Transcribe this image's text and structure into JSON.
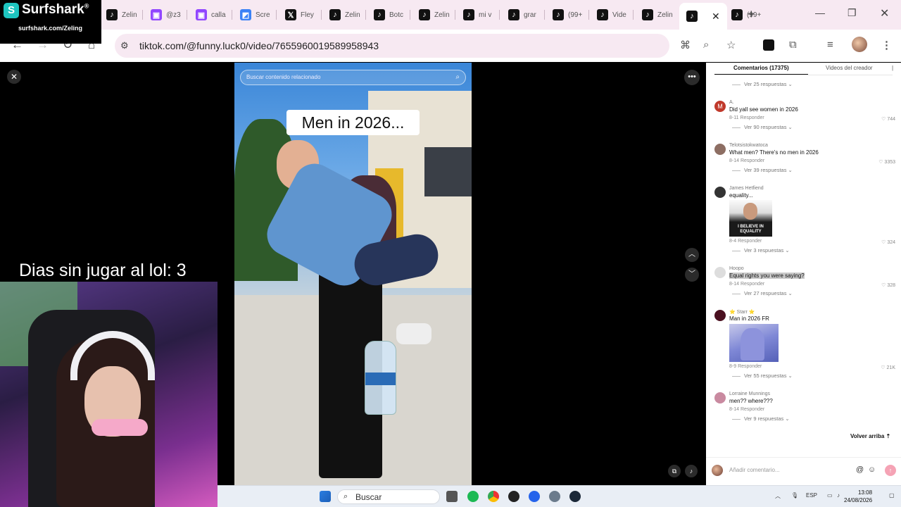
{
  "browser": {
    "tabs": [
      {
        "label": "Zelin",
        "icon": "tiktok-icon"
      },
      {
        "label": "@z3",
        "icon": "twitch-icon"
      },
      {
        "label": "calla",
        "icon": "twitch-icon"
      },
      {
        "label": "Scre",
        "icon": "screen-icon"
      },
      {
        "label": "Fley",
        "icon": "x-icon"
      },
      {
        "label": "Zelin",
        "icon": "tiktok-icon"
      },
      {
        "label": "Botc",
        "icon": "tiktok-icon"
      },
      {
        "label": "Zelin",
        "icon": "tiktok-icon"
      },
      {
        "label": "mi v",
        "icon": "tiktok-icon"
      },
      {
        "label": "grar",
        "icon": "tiktok-icon"
      },
      {
        "label": "(99+",
        "icon": "tiktok-icon"
      },
      {
        "label": "Vide",
        "icon": "tiktok-icon"
      },
      {
        "label": "Zelin",
        "icon": "tiktok-icon"
      },
      {
        "label": "",
        "icon": "tiktok-icon",
        "active": true
      },
      {
        "label": "(99+",
        "icon": "tiktok-icon"
      }
    ],
    "url": "tiktok.com/@funny.luck0/video/7655960019589958943"
  },
  "surfshark": {
    "logo_letter": "S",
    "name": "Surfshark",
    "trademark": "®",
    "url": "surfshark.com/Zeling"
  },
  "video": {
    "search_placeholder": "Buscar contenido relacionado",
    "caption": "Men in 2026..."
  },
  "comments": {
    "tab_comments": "Comentarios (17375)",
    "tab_creator": "Videos del creador",
    "items": [
      {
        "type": "replies",
        "label": "Ver 25 respuestas"
      },
      {
        "type": "comment",
        "user": "A.",
        "text": "Did yall see women in 2026",
        "date": "8-11",
        "reply": "Responder",
        "likes": "744",
        "avatar_color": "#c0392b",
        "avatar_letter": "M"
      },
      {
        "type": "replies",
        "label": "Ver 90 respuestas"
      },
      {
        "type": "comment",
        "user": "Telotsistokwatoca",
        "text": "What men? There's no men in 2026",
        "date": "8-14",
        "reply": "Responder",
        "likes": "3353",
        "avatar_color": "#8d6e63"
      },
      {
        "type": "replies",
        "label": "Ver 39 respuestas"
      },
      {
        "type": "comment",
        "user": "James Hetfiend",
        "text": "equality...",
        "date": "8-4",
        "reply": "Responder",
        "likes": "324",
        "avatar_color": "#333333",
        "image_caption": "I BELIEVE IN EQUALITY"
      },
      {
        "type": "replies",
        "label": "Ver 3 respuestas"
      },
      {
        "type": "comment",
        "user": "Hoopo",
        "text": "Equal rights you were saying?",
        "date": "8-14",
        "reply": "Responder",
        "likes": "328",
        "avatar_color": "#dddddd",
        "highlight": true
      },
      {
        "type": "replies",
        "label": "Ver 27 respuestas"
      },
      {
        "type": "comment",
        "user": "⭐ Starr ⭐",
        "text": "Man in 2026 FR",
        "date": "8-9",
        "reply": "Responder",
        "likes": "21K",
        "avatar_color": "#4a1020",
        "image": true
      },
      {
        "type": "replies",
        "label": "Ver 55 respuestas"
      },
      {
        "type": "comment",
        "user": "Lorraine Munnings",
        "text": "men?? where???",
        "date": "8-14",
        "reply": "Responder",
        "likes": "",
        "avatar_color": "#c98aa0"
      },
      {
        "type": "replies",
        "label": "Ver 9 respuestas"
      }
    ],
    "scroll_top": "Volver arriba",
    "input_placeholder": "Añadir comentario..."
  },
  "stream": {
    "overlay_text": "Dias sin jugar al lol: 3"
  },
  "taskbar": {
    "search_label": "Buscar",
    "language": "ESP",
    "time": "13:08",
    "date": "24/08/2026"
  }
}
